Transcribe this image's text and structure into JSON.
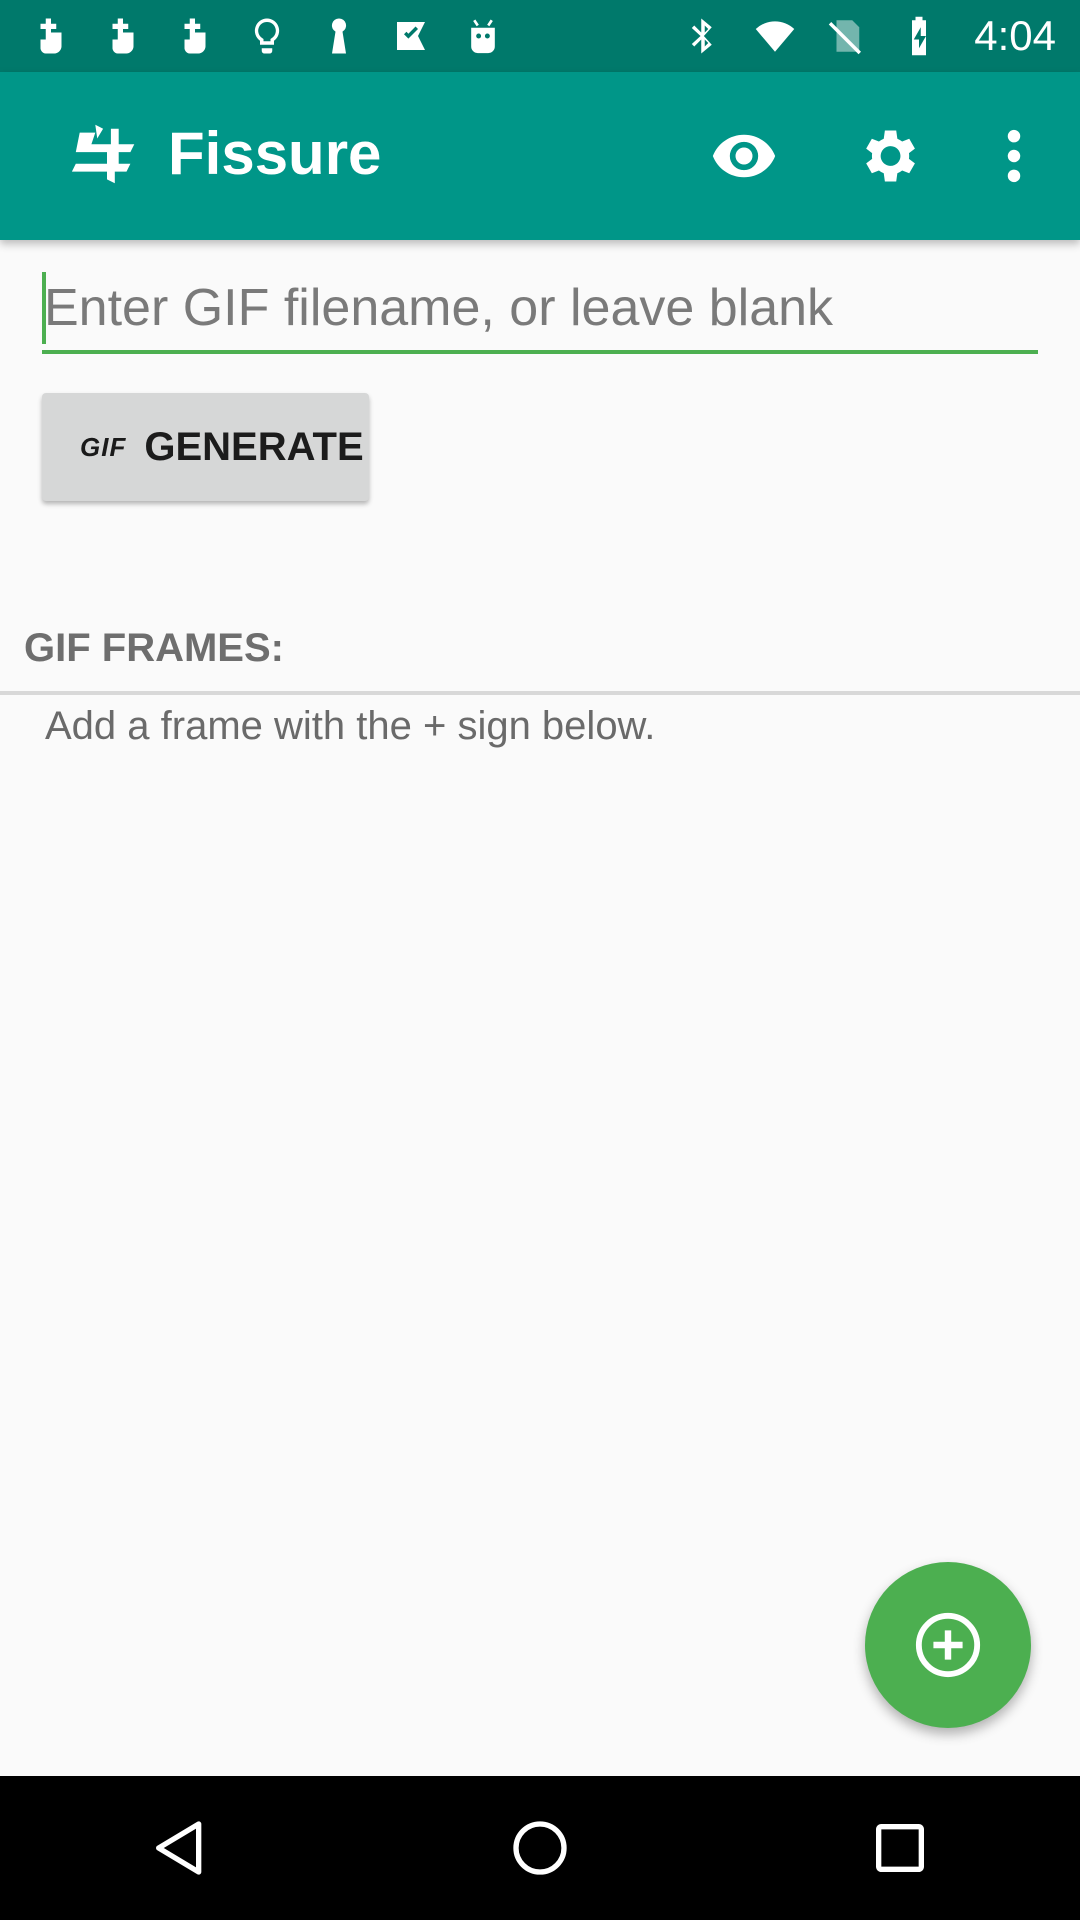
{
  "status_bar": {
    "time": "4:04",
    "left_icons": [
      "touch-icon",
      "touch-icon",
      "touch-icon",
      "lightbulb-icon",
      "keyhole-icon",
      "check-flag-icon",
      "android-icon"
    ],
    "right_icons": [
      "bluetooth-icon",
      "wifi-icon",
      "no-sim-icon",
      "battery-charging-icon"
    ]
  },
  "app_bar": {
    "title": "Fissure",
    "actions": [
      "eye-icon",
      "gear-icon",
      "more-vert-icon"
    ]
  },
  "filename_input": {
    "placeholder": "Enter GIF filename, or leave blank",
    "value": ""
  },
  "generate_button": {
    "icon_text": "GIF",
    "label": "GENERATE"
  },
  "frames": {
    "heading": "GIF FRAMES:",
    "empty_hint": "Add a frame with the + sign below."
  },
  "fab": {
    "icon": "add-circle-icon"
  },
  "nav_bar": {
    "buttons": [
      "back-icon",
      "home-icon",
      "recents-icon"
    ]
  },
  "colors": {
    "status_bar": "#00796b",
    "app_bar": "#009688",
    "accent": "#4caf50",
    "background": "#fafafa",
    "button": "#d6d7d7"
  }
}
